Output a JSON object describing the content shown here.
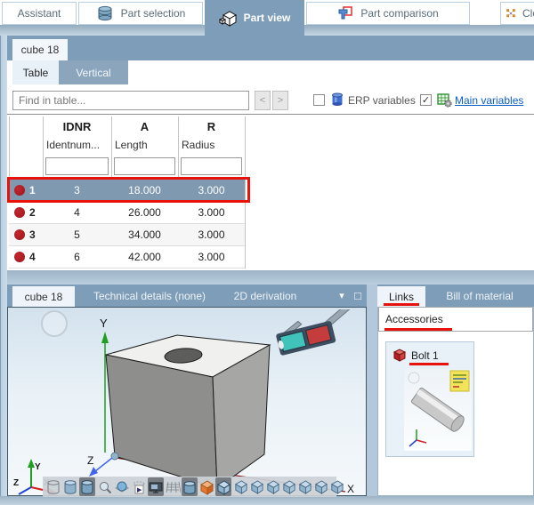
{
  "colors": {
    "header_blue": "#7e9db8",
    "selection_blue": "#7e99b0",
    "annotation_red": "#e8120c",
    "link_blue": "#0b5cc4",
    "row_dot_red": "#b42025"
  },
  "top_tabs": [
    {
      "label": "Assistant"
    },
    {
      "label": "Part selection",
      "icon": "database-icon"
    },
    {
      "label": "Part view",
      "icon": "part-cube-icon",
      "active": true
    },
    {
      "label": "Part comparison",
      "icon": "compare-icon"
    },
    {
      "label": "Clo",
      "icon": "network-icon",
      "truncated": true
    }
  ],
  "part_tab": "cube 18",
  "view_mode_tabs": [
    {
      "label": "Table",
      "active": true
    },
    {
      "label": "Vertical"
    }
  ],
  "find_bar": {
    "placeholder": "Find in table...",
    "prev_glyph": "<",
    "next_glyph": ">",
    "erp_checkbox": {
      "label": "ERP variables",
      "checked": false
    },
    "main_checkbox": {
      "label": "Main variables",
      "checked": true,
      "check_glyph": "✓"
    }
  },
  "table": {
    "columns": [
      {
        "code": "IDNR",
        "name": "Identnum..."
      },
      {
        "code": "A",
        "name": "Length"
      },
      {
        "code": "R",
        "name": "Radius"
      }
    ],
    "rows": [
      {
        "num": "1",
        "values": [
          "3",
          "18.000",
          "3.000"
        ],
        "selected": true
      },
      {
        "num": "2",
        "values": [
          "4",
          "26.000",
          "3.000"
        ],
        "selected": false
      },
      {
        "num": "3",
        "values": [
          "5",
          "34.000",
          "3.000"
        ],
        "selected": false
      },
      {
        "num": "4",
        "values": [
          "6",
          "42.000",
          "3.000"
        ],
        "selected": false
      }
    ]
  },
  "viewport": {
    "tabs": [
      {
        "label": "cube 18",
        "active": true
      },
      {
        "label": "Technical details (none)"
      },
      {
        "label": "2D derivation"
      }
    ],
    "dropdown_glyph": "▾",
    "maximize_glyph": "□",
    "axes": {
      "x": "X",
      "y": "Y",
      "z": "Z"
    },
    "toolbar_icons": [
      "cylinder-wireframe-icon",
      "cylinder-shaded-icon",
      "cylinder-solid-icon",
      "zoom-icon",
      "sphere-section-icon",
      "print-page-icon",
      "screen-icon",
      "mesh-icon",
      "cylinder-view-icon",
      "orange-face-icon",
      "cube-solid-icon",
      "cube-view-1-icon",
      "cube-view-2-icon",
      "cube-view-3-icon",
      "cube-view-4-icon",
      "cube-view-5-icon",
      "cube-view-6-icon",
      "cube-view-7-icon"
    ]
  },
  "right_panel": {
    "tabs": [
      {
        "label": "Links",
        "active": true
      },
      {
        "label": "Bill of material"
      }
    ],
    "group_label": "Accessories",
    "items": [
      {
        "name": "Bolt 1"
      }
    ]
  }
}
